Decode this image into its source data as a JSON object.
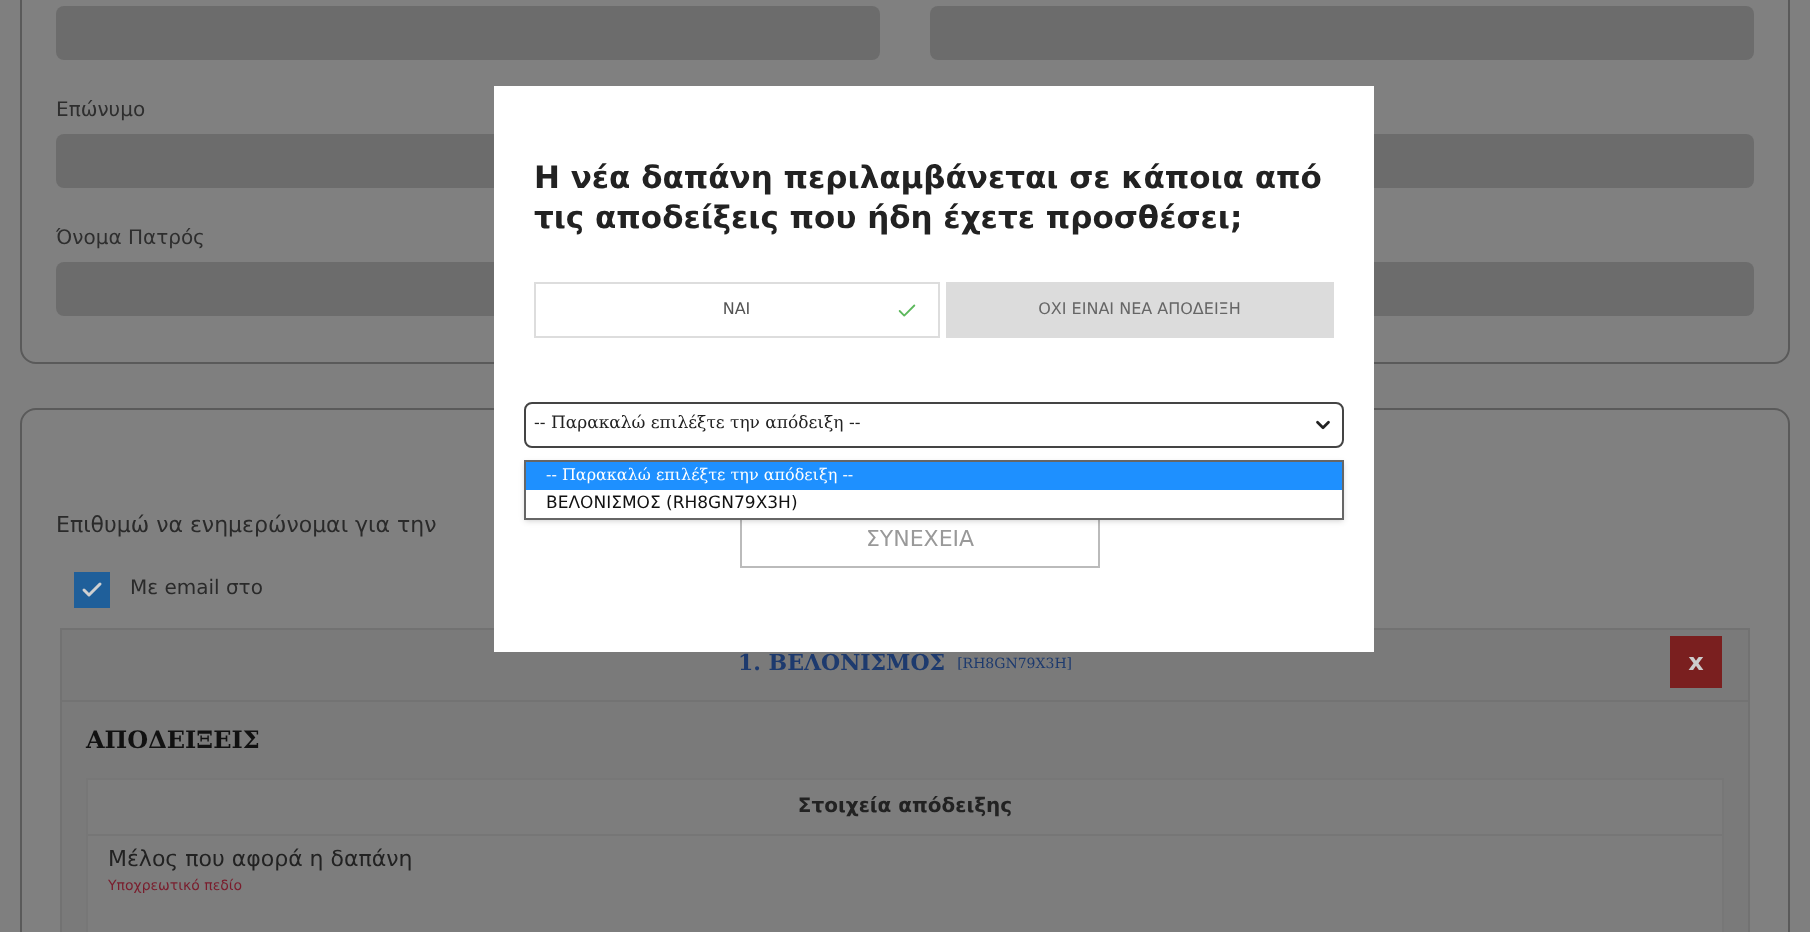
{
  "personal_card": {
    "fields": [
      {
        "label": "Επώνυμο"
      },
      {
        "label": "Όνομα Πατρός"
      }
    ]
  },
  "notifications_card": {
    "prompt": "Επιθυμώ να ενημερώνομαι για την",
    "email_option": {
      "label": "Με email στο",
      "checked": true
    }
  },
  "expense": {
    "title": "1. ΒΕΛΟΝΙΣΜΟΣ",
    "code": "[RH8GN79X3H]",
    "remove": "x",
    "section": "ΑΠΟΔΕΙΞΕΙΣ",
    "table": {
      "header": "Στοιχεία απόδειξης",
      "row_label": "Μέλος που αφορά η δαπάνη",
      "required_note": "Υποχρεωτικό πεδίο"
    }
  },
  "modal": {
    "question": "Η νέα δαπάνη περιλαμβάνεται σε κάποια από τις αποδείξεις που ήδη έχετε προσθέσει;",
    "choices": [
      {
        "label": "ΝΑΙ",
        "selected": true
      },
      {
        "label": "ΟΧΙ ΕΙΝΑΙ ΝΕΑ ΑΠΟΔΕΙΞΗ",
        "selected": false
      }
    ],
    "select": {
      "value": "-- Παρακαλώ επιλέξτε την απόδειξη --",
      "expanded": true,
      "options": [
        {
          "label": "-- Παρακαλώ επιλέξτε την απόδειξη --",
          "selected": true
        },
        {
          "label": "ΒΕΛΟΝΙΣΜΟΣ (RH8GN79X3H)",
          "selected": false
        }
      ]
    },
    "continue": "ΣΥΝΕΧΕΙΑ"
  }
}
